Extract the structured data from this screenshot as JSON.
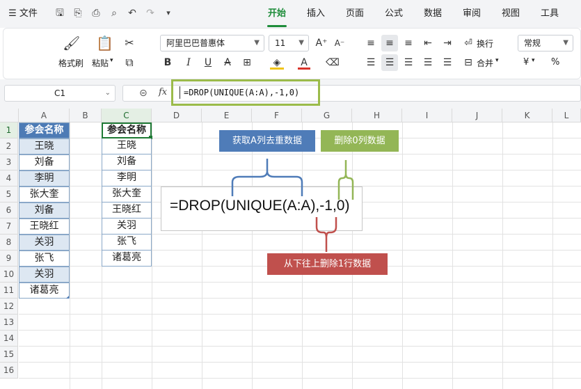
{
  "topbar": {
    "menu_label": "文件",
    "tabs": [
      "开始",
      "插入",
      "页面",
      "公式",
      "数据",
      "审阅",
      "视图",
      "工具"
    ],
    "active_tab": "开始"
  },
  "ribbon": {
    "format_painter": "格式刷",
    "paste": "粘贴",
    "font_name": "阿里巴巴普惠体",
    "font_size": "11",
    "wrap": "换行",
    "merge": "合并",
    "number_format": "常规",
    "currency": "¥",
    "percent": "%"
  },
  "formula_bar": {
    "cell_ref": "C1",
    "fx": "fx",
    "formula": "=DROP(UNIQUE(A:A),-1,0)"
  },
  "grid": {
    "columns": [
      "A",
      "B",
      "C",
      "D",
      "E",
      "F",
      "G",
      "H",
      "I",
      "J",
      "K",
      "L"
    ],
    "rows": [
      "1",
      "2",
      "3",
      "4",
      "5",
      "6",
      "7",
      "8",
      "9",
      "10",
      "11",
      "12",
      "13",
      "14",
      "15",
      "16"
    ],
    "column_a": [
      "参会名称",
      "王晓",
      "刘备",
      "李明",
      "张大奎",
      "刘备",
      "王晓红",
      "关羽",
      "张飞",
      "关羽",
      "诸葛亮"
    ],
    "column_c": [
      "参会名称",
      "王晓",
      "刘备",
      "李明",
      "张大奎",
      "王晓红",
      "关羽",
      "张飞",
      "诸葛亮"
    ]
  },
  "annotation": {
    "formula": "=DROP(UNIQUE(A:A),-1,0)",
    "label_unique": "获取A列去重数据",
    "label_cols": "删除0列数据",
    "label_rows": "从下往上删除1行数据",
    "colors": {
      "blue": "#4f7cb8",
      "green": "#93b656",
      "red": "#c0504d"
    }
  }
}
